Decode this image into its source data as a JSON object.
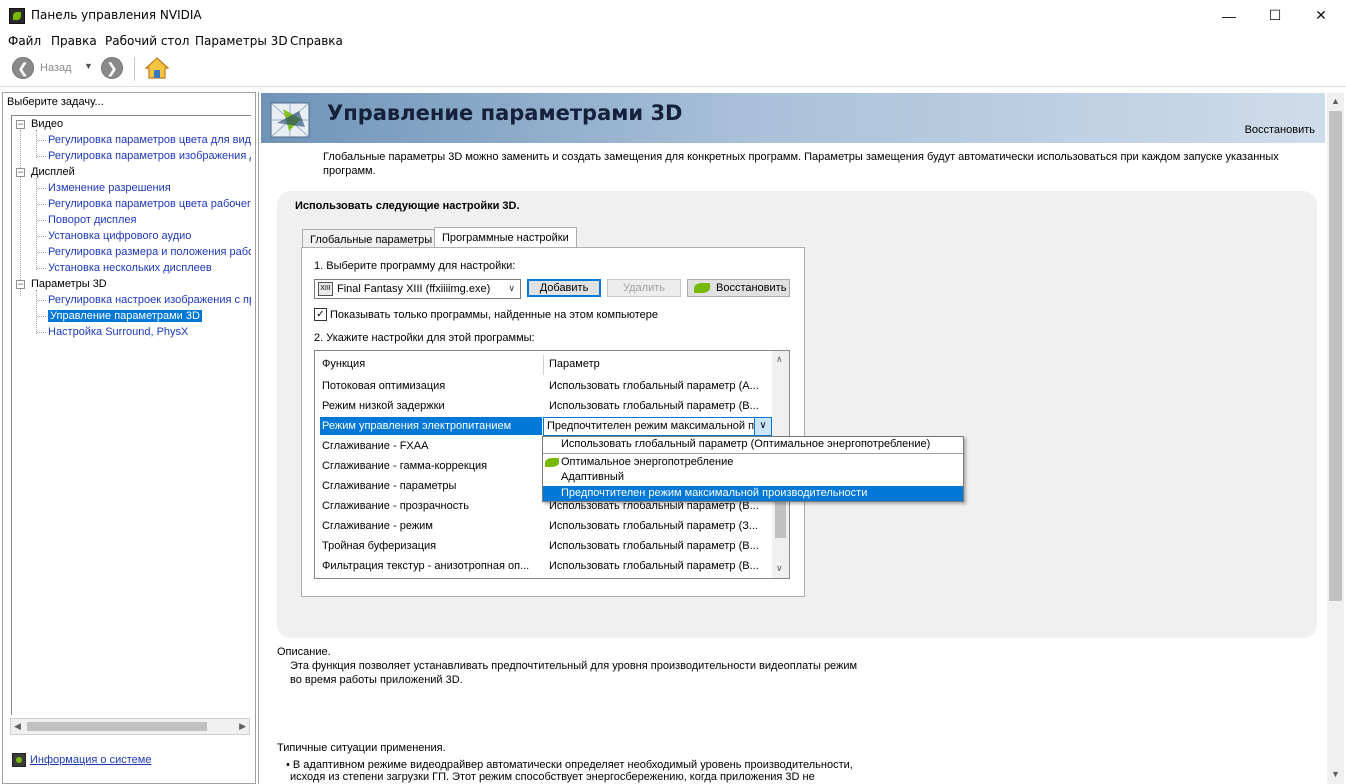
{
  "window": {
    "title": "Панель управления NVIDIA"
  },
  "menu": [
    "Файл",
    "Правка",
    "Рабочий стол",
    "Параметры 3D",
    "Справка"
  ],
  "toolbar": {
    "back_label": "Назад"
  },
  "sidebar": {
    "header": "Выберите задачу...",
    "groups": [
      {
        "label": "Видео",
        "items": [
          "Регулировка параметров цвета для вид",
          "Регулировка параметров изображения д"
        ]
      },
      {
        "label": "Дисплей",
        "items": [
          "Изменение разрешения",
          "Регулировка параметров цвета рабочег",
          "Поворот дисплея",
          "Установка цифрового аудио",
          "Регулировка размера и положения рабо",
          "Установка нескольких дисплеев"
        ]
      },
      {
        "label": "Параметры 3D",
        "items": [
          "Регулировка настроек изображения с пр",
          "Управление параметрами 3D",
          "Настройка Surround, PhysX"
        ]
      }
    ],
    "selected_item": "Управление параметрами 3D",
    "system_info": "Информация о системе"
  },
  "page": {
    "title": "Управление параметрами 3D",
    "restore_link": "Восстановить",
    "intro_line1": "Глобальные параметры 3D можно заменить и создать замещения для конкретных программ. Параметры замещения будут автоматически использоваться при каждом запуске указанных",
    "intro_line2": "программ.",
    "section_header": "Использовать следующие настройки 3D.",
    "tabs": [
      "Глобальные параметры",
      "Программные настройки"
    ],
    "active_tab": "Программные настройки",
    "step1_label": "1. Выберите программу для настройки:",
    "program_select": "Final Fantasy XIII (ffxiiiimg.exe)",
    "add_button": "Добавить",
    "remove_button": "Удалить",
    "restore_button": "Восстановить",
    "show_only_checkbox": "Показывать только программы, найденные на этом компьютере",
    "show_only_checked": true,
    "step2_label": "2. Укажите настройки для этой программы:",
    "grid": {
      "headers": [
        "Функция",
        "Параметр"
      ],
      "rows": [
        {
          "feature": "Потоковая оптимизация",
          "value": "Использовать глобальный параметр (А..."
        },
        {
          "feature": "Режим низкой задержки",
          "value": "Использовать глобальный параметр (В..."
        },
        {
          "feature": "Режим управления электропитанием",
          "value": "Предпочтителен режим максимальной пр"
        },
        {
          "feature": "Сглаживание - FXAA",
          "value": ""
        },
        {
          "feature": "Сглаживание - гамма-коррекция",
          "value": ""
        },
        {
          "feature": "Сглаживание - параметры",
          "value": ""
        },
        {
          "feature": "Сглаживание - прозрачность",
          "value": "Использовать глобальный параметр (В..."
        },
        {
          "feature": "Сглаживание - режим",
          "value": "Использовать глобальный параметр (З..."
        },
        {
          "feature": "Тройная буферизация",
          "value": "Использовать глобальный параметр (В..."
        },
        {
          "feature": "Фильтрация текстур - анизотропная оп...",
          "value": "Использовать глобальный параметр (В..."
        }
      ],
      "selected_row": 2
    },
    "dropdown_options": [
      "Использовать глобальный параметр (Оптимальное энергопотребление)",
      "Оптимальное энергопотребление",
      "Адаптивный",
      "Предпочтителен режим максимальной производительности"
    ],
    "dropdown_selected": 3,
    "description_label": "Описание.",
    "description_line1": "Эта функция позволяет устанавливать предпочтительный для уровня производительности видеоплаты режим",
    "description_line2": "во время работы приложений 3D.",
    "usage_label": "Типичные ситуации применения.",
    "usage_line1": "• В адаптивном режиме видеодрайвер автоматически определяет необходимый уровень производительности,",
    "usage_line2": "исходя из степени загрузки ГП. Этот режим способствует энергосбережению, когда приложения 3D не"
  },
  "colors": {
    "accent": "#0078d7",
    "nvidia_green": "#76b900",
    "link": "#1c39bb"
  }
}
